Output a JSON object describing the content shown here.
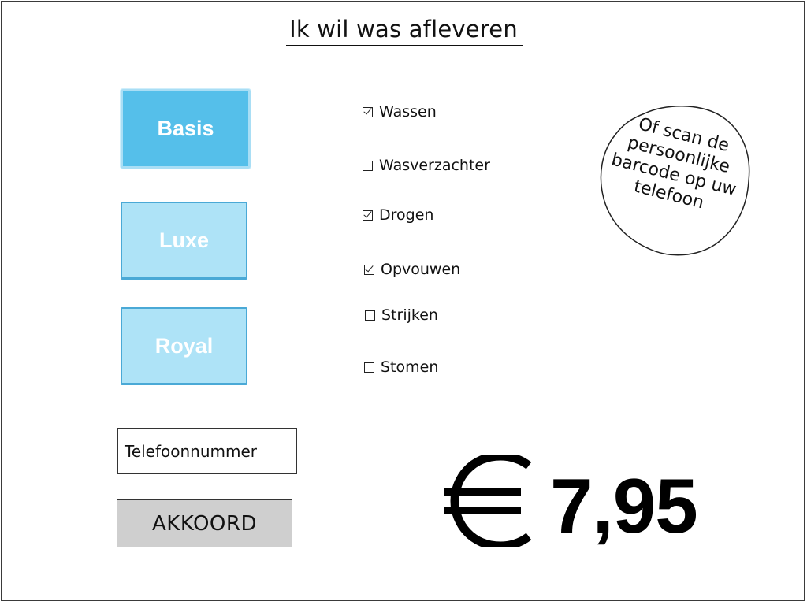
{
  "title": "Ik wil was afleveren",
  "packages": [
    {
      "label": "Basis",
      "selected": true
    },
    {
      "label": "Luxe",
      "selected": false
    },
    {
      "label": "Royal",
      "selected": false
    }
  ],
  "options": [
    {
      "label": "Wassen",
      "checked": true
    },
    {
      "label": "Wasverzachter",
      "checked": false
    },
    {
      "label": "Drogen",
      "checked": true
    },
    {
      "label": "Opvouwen",
      "checked": true
    },
    {
      "label": "Strijken",
      "checked": false
    },
    {
      "label": "Stomen",
      "checked": false
    }
  ],
  "scan_note": "Of scan de persoonlijke barcode op uw telefoon",
  "phone_field": {
    "value": "Telefoonnummer"
  },
  "submit_label": "AKKOORD",
  "price": {
    "currency_icon": "euro-sign-icon",
    "amount": "7,95"
  },
  "colors": {
    "selected_button": "#55bfea",
    "button": "#aee3f7",
    "button_border": "#4aa9d6",
    "submit_button": "#cfcfcf"
  }
}
